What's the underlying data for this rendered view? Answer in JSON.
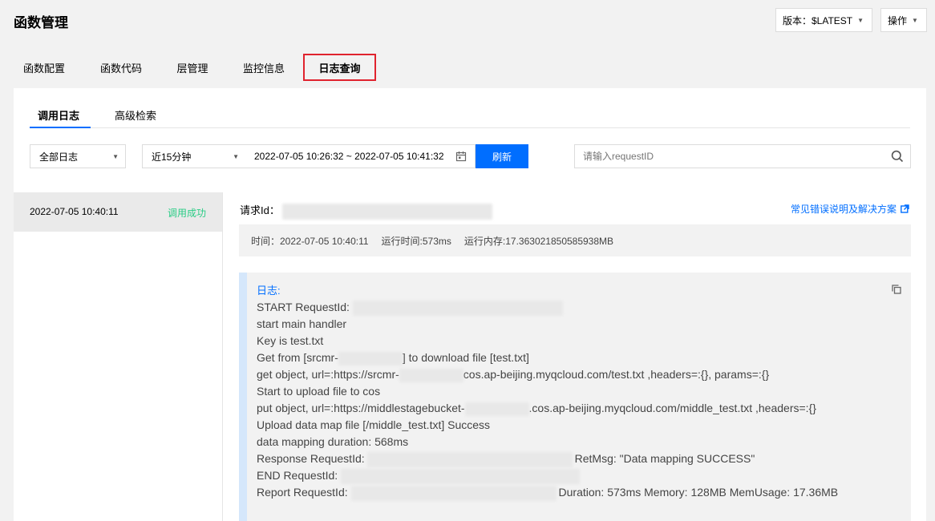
{
  "page": {
    "title": "函数管理"
  },
  "top_actions": {
    "version_label": "版本：$LATEST",
    "ops_label": "操作"
  },
  "main_tabs": [
    {
      "label": "函数配置"
    },
    {
      "label": "函数代码"
    },
    {
      "label": "层管理"
    },
    {
      "label": "监控信息"
    },
    {
      "label": "日志查询",
      "active": true
    }
  ],
  "sub_tabs": [
    {
      "label": "调用日志",
      "active": true
    },
    {
      "label": "高级检索"
    }
  ],
  "filters": {
    "log_type": "全部日志",
    "time_range": "近15分钟",
    "date_range": "2022-07-05 10:26:32 ~ 2022-07-05 10:41:32",
    "refresh_label": "刷新",
    "search_placeholder": "请输入requestID"
  },
  "log_list": [
    {
      "time": "2022-07-05 10:40:11",
      "status": "调用成功"
    }
  ],
  "detail": {
    "request_id_label": "请求Id：",
    "help_link": "常见错误说明及解决方案",
    "info": {
      "time": "时间：2022-07-05 10:40:11",
      "duration": "运行时间:573ms",
      "memory": "运行内存:17.363021850585938MB"
    },
    "log_title": "日志:",
    "log_lines": [
      {
        "pre": "START RequestId: ",
        "post": ""
      },
      {
        "pre": "start main handler",
        "post": ""
      },
      {
        "pre": "Key is test.txt",
        "post": ""
      },
      {
        "pre": "Get from [srcmr-",
        "post": "] to download file [test.txt]"
      },
      {
        "pre": "get object, url=:https://srcmr-",
        "post": "cos.ap-beijing.myqcloud.com/test.txt ,headers=:{}, params=:{}"
      },
      {
        "pre": "Start to upload file to cos",
        "post": ""
      },
      {
        "pre": "put object, url=:https://middlestagebucket-",
        "post": ".cos.ap-beijing.myqcloud.com/middle_test.txt ,headers=:{}"
      },
      {
        "pre": "Upload data map file [/middle_test.txt] Success",
        "post": ""
      },
      {
        "pre": "data mapping duration: 568ms",
        "post": ""
      },
      {
        "pre": "Response RequestId:",
        "post": "RetMsg: \"Data mapping SUCCESS\""
      },
      {
        "pre": "END RequestId: ",
        "post": ""
      },
      {
        "pre": "Report RequestId: ",
        "post": "Duration: 573ms Memory: 128MB MemUsage: 17.36MB"
      }
    ]
  },
  "colors": {
    "primary": "#006eff",
    "success": "#29cc85",
    "active_tab_border": "#e0232e",
    "log_accent": "#d5e7fb"
  }
}
